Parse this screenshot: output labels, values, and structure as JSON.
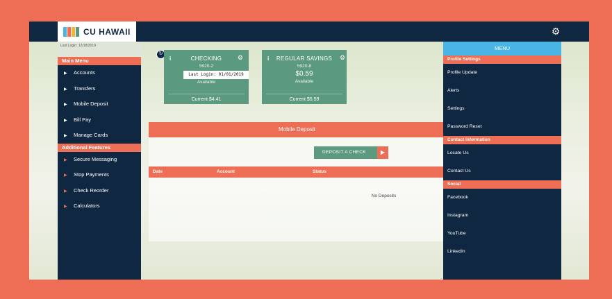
{
  "brand": {
    "name": "CU HAWAII",
    "logo_colors": [
      "#4ab5e4",
      "#ee6e55",
      "#f3b33d",
      "#5b9a7e"
    ]
  },
  "sidebar": {
    "last_login_small": "Last Login: 12/18/2019",
    "main_menu_title": "Main Menu",
    "main_items": [
      {
        "label": "Accounts"
      },
      {
        "label": "Transfers"
      },
      {
        "label": "Mobile Deposit"
      },
      {
        "label": "Bill Pay"
      },
      {
        "label": "Manage Cards"
      }
    ],
    "additional_title": "Additional Features",
    "additional_items": [
      {
        "label": "Secure Messaging"
      },
      {
        "label": "Stop Payments"
      },
      {
        "label": "Check Reorder"
      },
      {
        "label": "Calculators"
      }
    ]
  },
  "accounts": [
    {
      "title": "CHECKING",
      "number": "5920-2",
      "balance": "",
      "available": "Available",
      "current": "Current $4.41"
    },
    {
      "title": "REGULAR SAVINGS",
      "number": "5920-8",
      "balance": "$0.59",
      "available": "Available",
      "current": "Current $5.59"
    }
  ],
  "last_login_overlay": "Last Login: 01/01/2019",
  "main": {
    "title": "Mobile Deposit",
    "deposit_button": "DEPOSIT A CHECK",
    "columns": [
      "Date",
      "Account",
      "Status"
    ],
    "empty_text": "No Deposits"
  },
  "right_menu": {
    "title": "MENU",
    "sections": [
      {
        "title": "Profile Settings",
        "items": [
          "Profile Update",
          "Alerts",
          "Settings",
          "Password Reset"
        ]
      },
      {
        "title": "Contact Information",
        "items": [
          "Locate Us",
          "Contact Us"
        ]
      },
      {
        "title": "Social",
        "items": [
          "Facebook",
          "Instagram",
          "YouTube",
          "LinkedIn"
        ]
      }
    ]
  },
  "colors": {
    "navy": "#0f2741",
    "coral": "#ee6e55",
    "green": "#5b9a7e",
    "sky": "#4ab5e4"
  }
}
